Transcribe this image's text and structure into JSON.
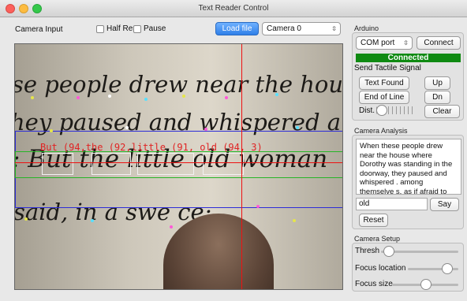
{
  "window": {
    "title": "Text Reader Control"
  },
  "left": {
    "camera_input_label": "Camera Input",
    "half_res_label": "Half Res",
    "pause_label": "Pause",
    "load_file_label": "Load file",
    "camera_select_value": "Camera 0"
  },
  "view": {
    "lines": [
      "se people drew near the house",
      "hey paused and whispered ar",
      ": But the little old woman",
      "said, in a swe      ce:"
    ],
    "overlay_text": "But (94,the (92,little (91, old (94, 3)"
  },
  "arduino": {
    "group_label": "Arduino",
    "port_select_value": "COM port",
    "connect_label": "Connect",
    "status_text": "Connected",
    "send_label": "Send Tactile Signal",
    "text_found_label": "Text Found",
    "up_label": "Up",
    "end_of_line_label": "End of Line",
    "dn_label": "Dn",
    "dist_label": "Dist.",
    "clear_label": "Clear"
  },
  "analysis": {
    "group_label": "Camera Analysis",
    "text": "When these people drew near the house where Dorothy was standing in the doorway, they paused and whispered . among themselve s, as if afraid to come farther. But the little",
    "word_value": "old",
    "say_label": "Say",
    "reset_label": "Reset"
  },
  "setup": {
    "group_label": "Camera Setup",
    "thresh_label": "Thresh",
    "focus_location_label": "Focus location",
    "focus_size_label": "Focus size",
    "thresh_level": 0.04,
    "focus_location_level": 0.85,
    "focus_size_level": 0.52
  }
}
